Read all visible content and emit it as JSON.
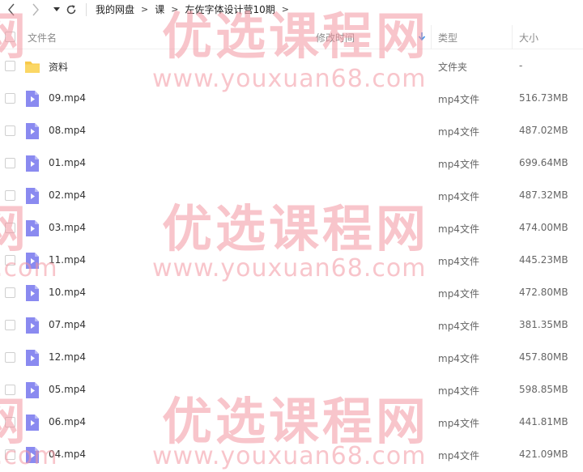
{
  "toolbar": {
    "back_icon": "chevron-left-icon",
    "forward_icon": "chevron-right-icon",
    "history_icon": "caret-down-icon",
    "refresh_icon": "refresh-icon"
  },
  "breadcrumb": {
    "items": [
      "我的网盘",
      "课",
      "左佐字体设计营10期"
    ],
    "separator": ">"
  },
  "columns": {
    "name": "文件名",
    "modified": "修改时间",
    "type": "类型",
    "size": "大小",
    "sort_icon": "sort-down-arrow-icon"
  },
  "files": [
    {
      "name": "资料",
      "type": "文件夹",
      "size": "-",
      "icon": "folder-icon"
    },
    {
      "name": "09.mp4",
      "type": "mp4文件",
      "size": "516.73MB",
      "icon": "video-file-icon"
    },
    {
      "name": "08.mp4",
      "type": "mp4文件",
      "size": "487.02MB",
      "icon": "video-file-icon"
    },
    {
      "name": "01.mp4",
      "type": "mp4文件",
      "size": "699.64MB",
      "icon": "video-file-icon"
    },
    {
      "name": "02.mp4",
      "type": "mp4文件",
      "size": "487.32MB",
      "icon": "video-file-icon"
    },
    {
      "name": "03.mp4",
      "type": "mp4文件",
      "size": "474.00MB",
      "icon": "video-file-icon"
    },
    {
      "name": "11.mp4",
      "type": "mp4文件",
      "size": "445.23MB",
      "icon": "video-file-icon"
    },
    {
      "name": "10.mp4",
      "type": "mp4文件",
      "size": "472.80MB",
      "icon": "video-file-icon"
    },
    {
      "name": "07.mp4",
      "type": "mp4文件",
      "size": "381.35MB",
      "icon": "video-file-icon"
    },
    {
      "name": "12.mp4",
      "type": "mp4文件",
      "size": "457.80MB",
      "icon": "video-file-icon"
    },
    {
      "name": "05.mp4",
      "type": "mp4文件",
      "size": "598.85MB",
      "icon": "video-file-icon"
    },
    {
      "name": "06.mp4",
      "type": "mp4文件",
      "size": "441.81MB",
      "icon": "video-file-icon"
    },
    {
      "name": "04.mp4",
      "type": "mp4文件",
      "size": "421.09MB",
      "icon": "video-file-icon"
    }
  ],
  "watermark": {
    "brand": "优选课程网",
    "url": "www.youxuan68.com",
    "edge_fragment": "网",
    "edge_com": ".com",
    "color": "#f296a0"
  },
  "colors": {
    "folder": "#f8c94a",
    "video_icon": "#8a8af0",
    "sort_arrow": "#3b8ee8"
  }
}
